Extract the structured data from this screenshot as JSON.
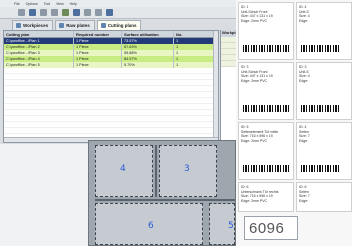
{
  "menu": [
    "File",
    "Options",
    "Tool",
    "View",
    "Help"
  ],
  "toolbar_icons": [
    "open-icon",
    "save-icon",
    "print-icon",
    "undo-icon",
    "settings-icon",
    "plan-icon",
    "cut-icon",
    "label-icon",
    "help-icon"
  ],
  "tabs": [
    {
      "label": "Workpieces",
      "active": false
    },
    {
      "label": "Raw plates",
      "active": false
    },
    {
      "label": "Cutting plans",
      "active": true
    }
  ],
  "grid": {
    "columns": [
      "Cutting plan",
      "Required number",
      "Surface utilisation",
      "No."
    ],
    "rows": [
      [
        "C:\\pwoffice...\\Plan 1",
        "1 Piece",
        "73.57%",
        "1"
      ],
      [
        "C:\\pwoffice...\\Plan 2",
        "1 Piece",
        "87.63%",
        "1"
      ],
      [
        "C:\\pwoffice...\\Plan 3",
        "1 Piece",
        "95.88%",
        "1"
      ],
      [
        "C:\\pwoffice...\\Plan 4",
        "1 Piece",
        "84.57%",
        "1"
      ],
      [
        "C:\\pwoffice...\\Plan 5",
        "1 Piece",
        "5.70%",
        "1"
      ]
    ]
  },
  "side_panel": {
    "header": "Workpiec"
  },
  "boards": [
    {
      "label": "4"
    },
    {
      "label": "3"
    },
    {
      "label": "6"
    },
    {
      "label": "5"
    }
  ],
  "counter": "6096",
  "labels": [
    {
      "lines": [
        "ID: 1",
        "Unit-Schub Front",
        "Size: 447 x 131 x 19",
        "Edge: 2mm PVC"
      ]
    },
    {
      "lines": [
        "ID: 4",
        "Unit-S",
        "Size: 4",
        "Edge:"
      ]
    },
    {
      "lines": [
        "ID: 3",
        "Unit-Schub Front",
        "Size: 447 x 131 x 19",
        "Edge: 2mm PVC"
      ]
    },
    {
      "lines": [
        "ID: 3",
        "Unit-S",
        "Size: 4",
        "Edge:"
      ]
    },
    {
      "lines": [
        "ID: 5",
        "Seitenelement Tür mitte",
        "Size: 716 x 596 x 19",
        "Edge: 2mm PVC"
      ]
    },
    {
      "lines": [
        "ID: 4",
        "Seiten",
        "Size: 7",
        "Edge:"
      ]
    },
    {
      "lines": [
        "ID: 6",
        "Unterschrank Tür rechts",
        "Size: 716 x 596 x 19",
        "Edge: 2mm PVC"
      ]
    },
    {
      "lines": [
        "ID: 6",
        "Seiten",
        "Size: 7",
        "Edge:"
      ]
    }
  ],
  "colors": {
    "selected_row": "#233a79",
    "highlight_row": "#c8ec82",
    "board_number": "#2a5bd7"
  }
}
